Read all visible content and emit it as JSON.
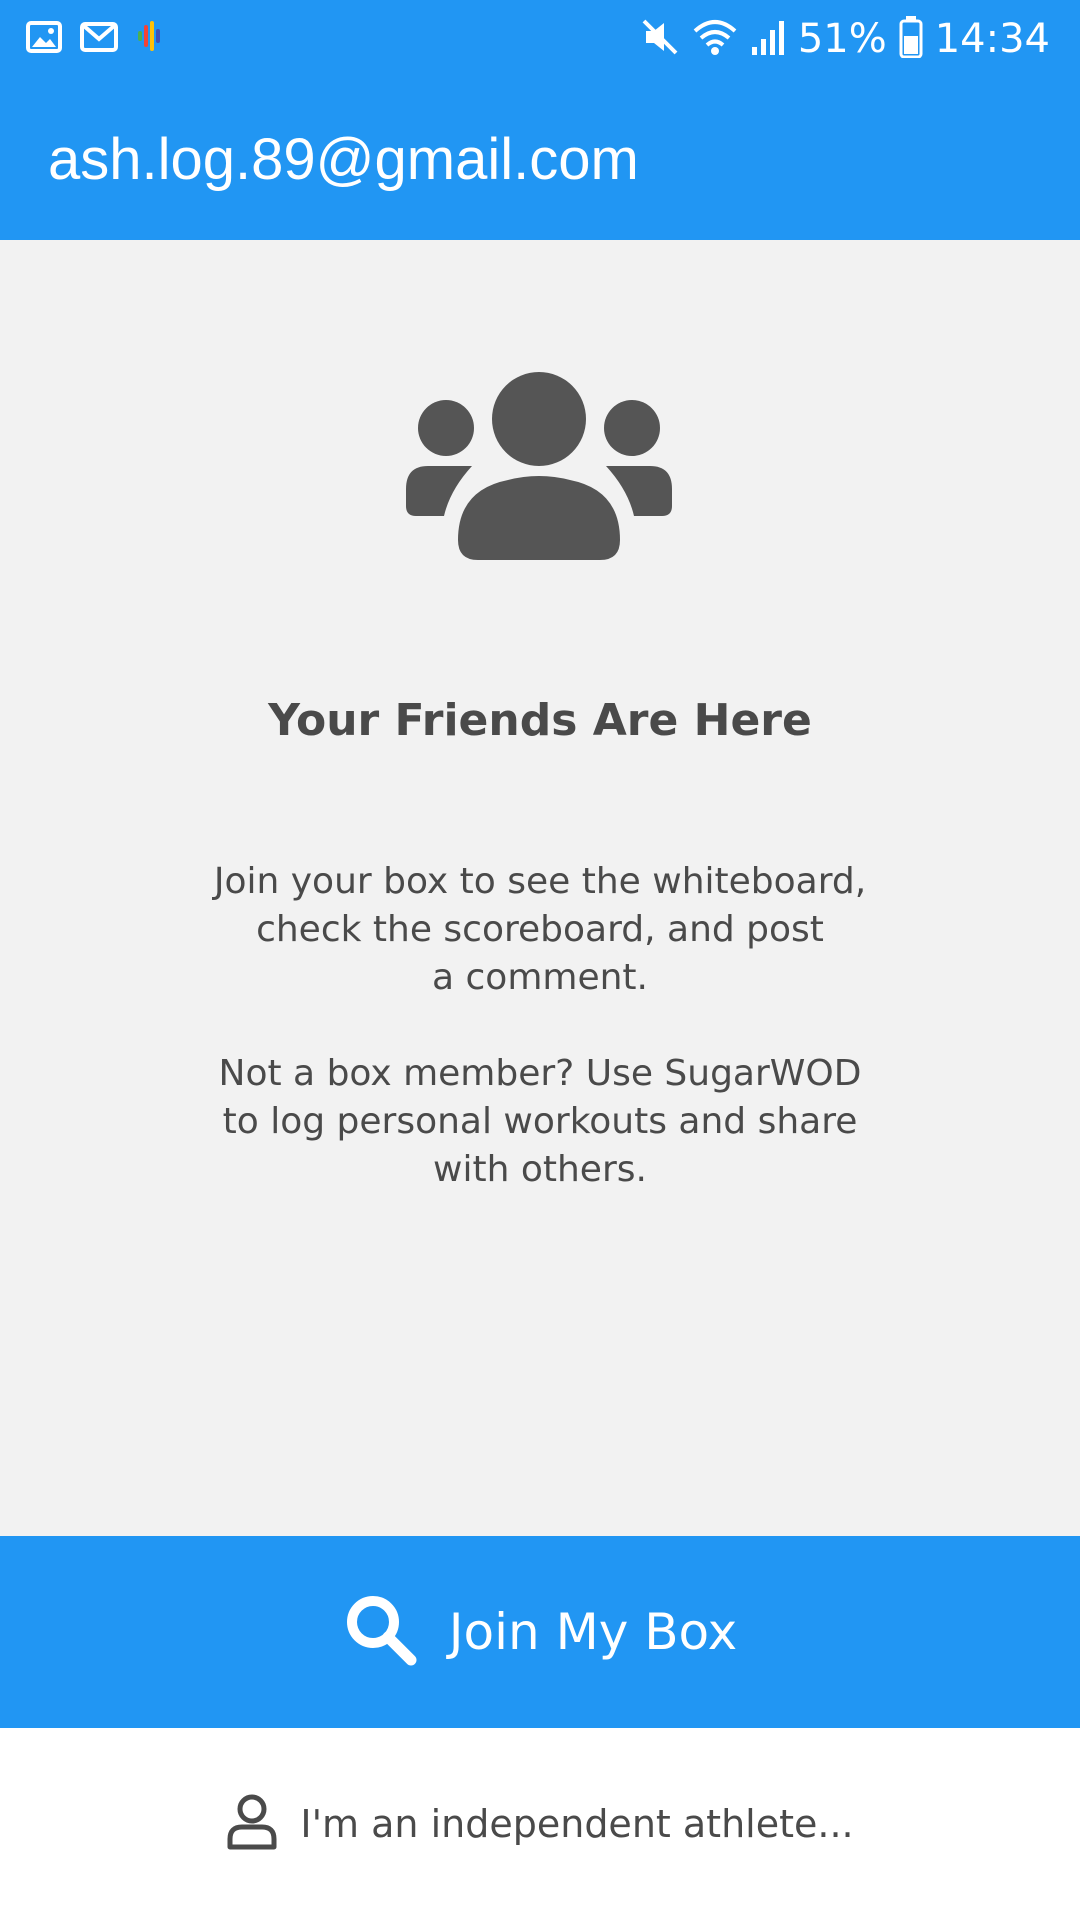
{
  "status_bar": {
    "left_icons": [
      "image-icon",
      "gmail-icon",
      "assistant-mic-icon"
    ],
    "right_icons": [
      "mute-icon",
      "wifi-icon",
      "signal-icon",
      "battery-icon"
    ],
    "battery": "51%",
    "time": "14:34"
  },
  "app_bar": {
    "title": "ash.log.89@gmail.com",
    "background": "#2196f3"
  },
  "content": {
    "icon": "friends-group-icon",
    "headline": "Your Friends Are Here",
    "paragraph1": "Join your box to see the whiteboard,\ncheck the scoreboard, and post\na comment.",
    "paragraph2": "Not a box member? Use SugarWOD\nto log personal workouts and share\nwith others."
  },
  "actions": {
    "join_label": "Join My Box",
    "join_icon": "search-icon",
    "independent_label": "I'm an independent athlete...",
    "independent_icon": "person-icon"
  },
  "colors": {
    "accent": "#2196f3",
    "text": "#4a4a4a",
    "background": "#f2f2f2"
  }
}
